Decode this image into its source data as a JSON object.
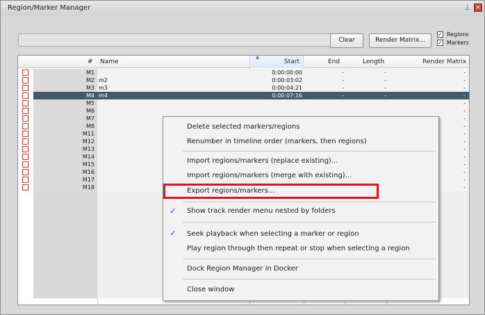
{
  "window": {
    "title": "Region/Marker Manager",
    "pin_glyph": "⊥",
    "close_glyph": "×"
  },
  "toolbar": {
    "clear_label": "Clear",
    "render_matrix_label": "Render Matrix...",
    "regions_label": "Regions",
    "markers_label": "Markers",
    "regions_checked": true,
    "markers_checked": true,
    "check_glyph": "✓"
  },
  "table": {
    "headers": {
      "num": "#",
      "name": "Name",
      "start": "Start",
      "end": "End",
      "length": "Length",
      "render_matrix": "Render Matrix"
    },
    "sort_glyph": "▲",
    "rows": [
      {
        "num": "M1",
        "name": "",
        "start": "0:00:00:00",
        "end": "-",
        "length": "-",
        "rm": "-"
      },
      {
        "num": "M2",
        "name": "m2",
        "start": "0:00:03:02",
        "end": "-",
        "length": "-",
        "rm": "-"
      },
      {
        "num": "M3",
        "name": "m3",
        "start": "0:00:04:21",
        "end": "-",
        "length": "-",
        "rm": "-"
      },
      {
        "num": "M4",
        "name": "m4",
        "start": "0:00:07:16",
        "end": "-",
        "length": "-",
        "rm": "-"
      },
      {
        "num": "M5",
        "name": "",
        "start": "",
        "end": "",
        "length": "",
        "rm": "-"
      },
      {
        "num": "M6",
        "name": "",
        "start": "",
        "end": "",
        "length": "",
        "rm": "-"
      },
      {
        "num": "M7",
        "name": "",
        "start": "",
        "end": "",
        "length": "",
        "rm": "-"
      },
      {
        "num": "M8",
        "name": "",
        "start": "",
        "end": "",
        "length": "",
        "rm": "-"
      },
      {
        "num": "M11",
        "name": "",
        "start": "",
        "end": "",
        "length": "",
        "rm": "-"
      },
      {
        "num": "M12",
        "name": "",
        "start": "",
        "end": "",
        "length": "",
        "rm": "-"
      },
      {
        "num": "M13",
        "name": "",
        "start": "",
        "end": "",
        "length": "",
        "rm": "-"
      },
      {
        "num": "M14",
        "name": "",
        "start": "",
        "end": "",
        "length": "",
        "rm": "-"
      },
      {
        "num": "M15",
        "name": "",
        "start": "",
        "end": "",
        "length": "",
        "rm": "-"
      },
      {
        "num": "M16",
        "name": "",
        "start": "",
        "end": "",
        "length": "",
        "rm": "-"
      },
      {
        "num": "M17",
        "name": "",
        "start": "",
        "end": "",
        "length": "",
        "rm": "-"
      },
      {
        "num": "M18",
        "name": "",
        "start": "",
        "end": "",
        "length": "",
        "rm": "-"
      }
    ]
  },
  "context_menu": {
    "items": {
      "delete": "Delete selected markers/regions",
      "renumber": "Renumber in timeline order (markers, then regions)",
      "import_replace": "Import regions/markers (replace existing)...",
      "import_merge": "Import regions/markers (merge with existing)...",
      "export": "Export regions/markers...",
      "show_track_render": "Show track render menu nested by folders",
      "seek_playback": "Seek playback when selecting a marker or region",
      "play_region": "Play region through then repeat or stop when selecting a region",
      "dock": "Dock Region Manager in Docker",
      "close": "Close window"
    },
    "checked_glyph": "✓",
    "highlight_color": "#e0131c"
  }
}
